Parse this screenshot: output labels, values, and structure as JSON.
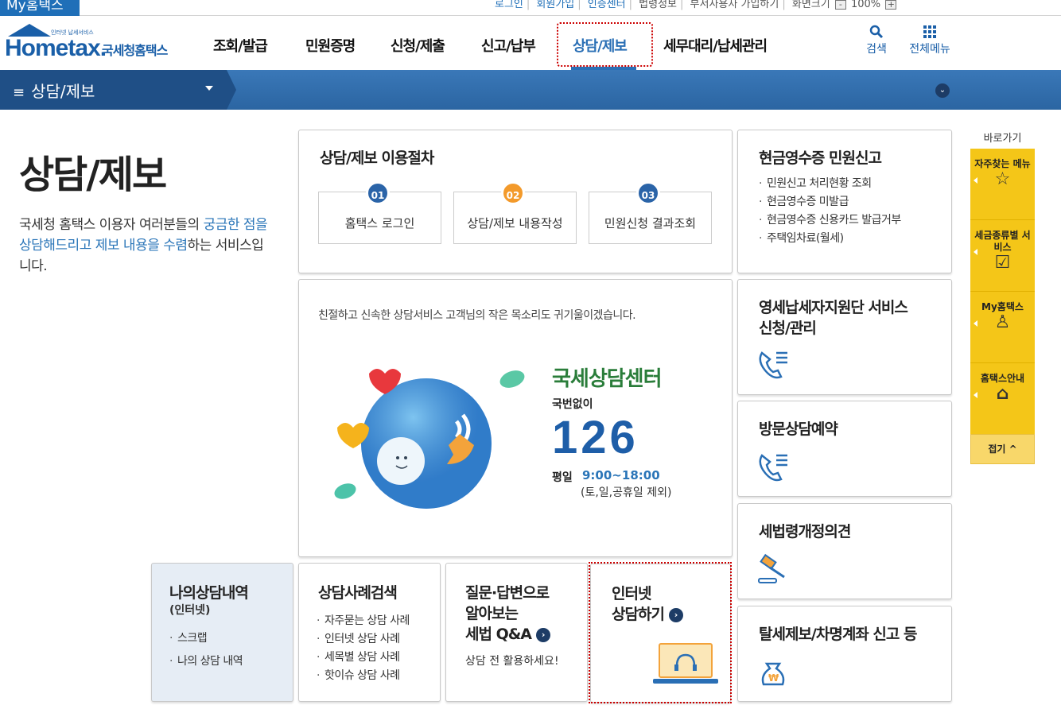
{
  "topbar": {
    "my_hometax": "My홈택스",
    "links": {
      "login": "로그인",
      "join": "회원가입",
      "cert": "인증센터",
      "law": "법령정보",
      "dept_join": "부서사용자 가입하기",
      "zoom_label": "화면크기",
      "zoom_value": "100%",
      "zoom_minus": "-",
      "zoom_plus": "+"
    }
  },
  "header": {
    "logo": {
      "brand": "Hometax.",
      "kr": "국세청홈택스",
      "tagline": "인터넷 납세서비스"
    },
    "nav": [
      "조회/발급",
      "민원증명",
      "신청/제출",
      "신고/납부",
      "상담/제보",
      "세무대리/납세관리"
    ],
    "search_label": "검색",
    "allmenu_label": "전체메뉴"
  },
  "menubar": {
    "title": "상담/제보"
  },
  "page": {
    "title": "상담/제보",
    "desc_1": "국세청 홈택스 이용자 여러분들의 ",
    "desc_hl1": "궁금한 점을 상담해드리고 제보 내용을 수렴",
    "desc_2": "하는 서비스입니다."
  },
  "procedure": {
    "title": "상담/제보 이용절차",
    "steps": [
      {
        "num": "01",
        "label": "홈택스 로그인",
        "color": "#2b64a8"
      },
      {
        "num": "02",
        "label": "상담/제보 내용작성",
        "color": "#f39a2b"
      },
      {
        "num": "03",
        "label": "민원신청 결과조회",
        "color": "#2b64a8"
      }
    ]
  },
  "cash_receipt": {
    "title": "현금영수증 민원신고",
    "items": [
      "민원신고 처리현황 조회",
      "현금영수증 미발급",
      "현금영수증 신용카드 발급거부",
      "주택임차료(월세)"
    ]
  },
  "center": {
    "slogan": "친절하고 신속한 상담서비스 고객님의 작은 목소리도 귀기울이겠습니다.",
    "name": "국세상담센터",
    "no_area_code": "국번없이",
    "number": "126",
    "weekday_label": "평일",
    "hours": "9:00~18:00",
    "closed": "(토,일,공휴일 제외)"
  },
  "right_cards": {
    "small_biz": "영세납세자지원단 서비스 신청/관리",
    "visit": "방문상담예약",
    "law_opinion": "세법령개정의견",
    "report": "탈세제보/차명계좌 신고 등"
  },
  "bottom": {
    "my_history": {
      "title": "나의상담내역",
      "sub": "(인터넷)",
      "items": [
        "스크랩",
        "나의 상담 내역"
      ]
    },
    "case_search": {
      "title": "상담사례검색",
      "items": [
        "자주묻는 상담 사례",
        "인터넷 상담 사례",
        "세목별 상담 사례",
        "핫이슈 상담 사례"
      ]
    },
    "qa": {
      "title_1": "질문·답변으로",
      "title_2": "알아보는",
      "title_3": "세법 Q&A",
      "sub": "상담 전 활용하세요!"
    },
    "internet": {
      "title_1": "인터넷",
      "title_2": "상담하기"
    }
  },
  "quick": {
    "title": "바로가기",
    "items": [
      {
        "label": "자주찾는 메뉴",
        "icon": "star-icon"
      },
      {
        "label": "세금종류별 서비스",
        "icon": "checkbox-icon"
      },
      {
        "label": "My홈택스",
        "icon": "person-icon"
      },
      {
        "label": "홈택스안내",
        "icon": "home-icon"
      }
    ],
    "fold": "접기 ^"
  }
}
